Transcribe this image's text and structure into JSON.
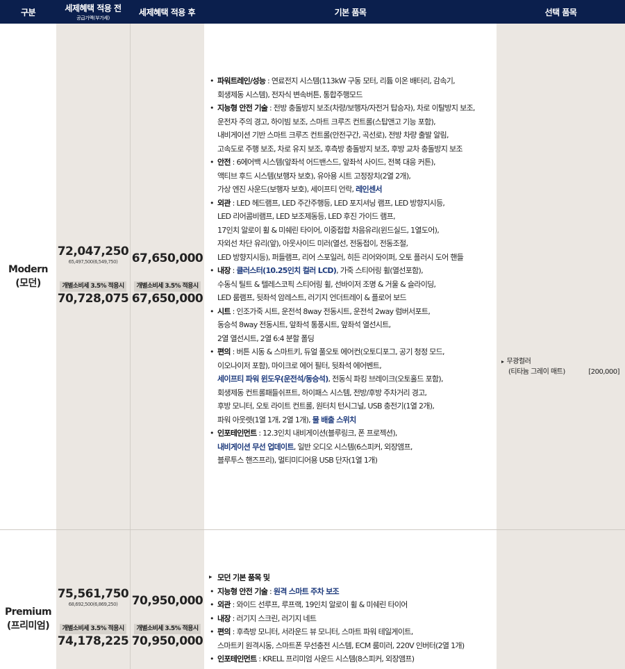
{
  "header": {
    "gubun": "구분",
    "before": "세제혜택 적용 전",
    "before_sub": "공급가액(부가세)",
    "after": "세제혜택 적용 후",
    "basic": "기본 품목",
    "option": "선택 품목"
  },
  "modern": {
    "name1": "Modern",
    "name2": "(모던)",
    "before_price": "72,047,250",
    "before_supply": "65,497,500(6,549,750)",
    "tax_label": "개별소비세 3.5% 적용시",
    "before_tax_price": "70,728,075",
    "after_price": "67,650,000",
    "after_tax_label": "개별소비세 3.5% 적용시",
    "after_tax_price": "67,650,000",
    "items": [
      {
        "cat": "파워트레인/성능",
        "parts": [
          {
            "t": " : 연료전지 시스템(113kW 구동 모터, 리튬 이온 배터리, 감속기,"
          },
          {
            "t": "회생제동 시스템), 전자식 변속버튼, 통합주행모드",
            "br": true
          }
        ]
      },
      {
        "cat": "지능형 안전 기술",
        "parts": [
          {
            "t": " : 전방 충돌방지 보조(차량/보행자/자전거 탑승자), 차로 이탈방지 보조,"
          },
          {
            "t": "운전자 주의 경고, 하이빔 보조, 스마트 크루즈 컨트롤(스탑앤고 기능 포함),",
            "br": true
          },
          {
            "t": "내비게이션 기반 스마트 크루즈 컨트롤(안전구간, 곡선로), 전방 차량 출발 알림,",
            "br": true
          },
          {
            "t": "고속도로 주행 보조, 차로 유지 보조, 후측방 충돌방지 보조, 후방 교차 충돌방지 보조",
            "br": true
          }
        ]
      },
      {
        "cat": "안전",
        "parts": [
          {
            "t": " : 6에어백 시스템(앞좌석 어드밴스드, 앞좌석 사이드, 전복 대응 커튼),"
          },
          {
            "t": "액티브 후드 시스템(보행자 보호), 유아용 시트 고정장치(2열 2개),",
            "br": true
          },
          {
            "t": "가상 엔진 사운드(보행자 보호), 세이프티 언락, ",
            "br": true
          },
          {
            "t": "레인센서",
            "hl": true
          }
        ]
      },
      {
        "cat": "외관",
        "parts": [
          {
            "t": " : LED 헤드램프, LED 주간주행등, LED 포지셔닝 램프, LED 방향지시등,"
          },
          {
            "t": "LED 리어콤비램프, LED 보조제동등, LED 후진 가이드 램프,",
            "br": true
          },
          {
            "t": "17인치 알로이 휠 & 미쉐린 타이어, 이중접합 차음유리(윈드실드, 1열도어),",
            "br": true
          },
          {
            "t": "자외선 차단 유리(앞), 아웃사이드 미러(열선, 전동접이, 전동조절,",
            "br": true
          },
          {
            "t": "LED 방향지시등), 퍼들램프, 리어 스포일러, 히든 리어와이퍼, 오토 플러시 도어 핸들",
            "br": true
          }
        ]
      },
      {
        "cat": "내장",
        "parts": [
          {
            "t": " : "
          },
          {
            "t": "클러스터(10.25인치 컬러 LCD)",
            "hl": true
          },
          {
            "t": ", 가죽 스티어링 휠(열선포함),"
          },
          {
            "t": "수동식 틸트 & 텔레스코픽 스티어링 휠, 선바이저 조명 & 거울 & 슬라이딩,",
            "br": true
          },
          {
            "t": "LED 룸램프, 뒷좌석 암레스트, 러기지 언더트레이 & 플로어 보드",
            "br": true
          }
        ]
      },
      {
        "cat": "시트",
        "parts": [
          {
            "t": " : 인조가죽 시트, 운전석 8way 전동시트, 운전석 2way 럼버서포트,"
          },
          {
            "t": "동승석 8way 전동시트, 앞좌석 통풍시트, 앞좌석 열선시트,",
            "br": true
          },
          {
            "t": "2열 열선시트, 2열 6:4 분할 폴딩",
            "br": true
          }
        ]
      },
      {
        "cat": "편의",
        "parts": [
          {
            "t": " : 버튼 시동 & 스마트키, 듀얼 풀오토 에어컨(오토디포그, 공기 청정 모드,"
          },
          {
            "t": "이오나이저 포함), 마이크로 에어 필터, 뒷좌석 에어벤트,",
            "br": true
          },
          {
            "t": "세이프티 파워 윈도우(운전석/동승석)",
            "hl": true,
            "br": true
          },
          {
            "t": ", 전동식 파킹 브레이크(오토홀드 포함),"
          },
          {
            "t": "회생제동 컨트롤패들쉬프트, 하이패스 시스템, 전방/후방 주차거리 경고,",
            "br": true
          },
          {
            "t": "후방 모니터, 오토 라이트 컨트롤, 원터치 턴시그널, USB 충전기(1열 2개),",
            "br": true
          },
          {
            "t": "파워 아웃렛(1열 1개, 2열 1개), ",
            "br": true
          },
          {
            "t": "물 배출 스위치",
            "hl": true
          }
        ]
      },
      {
        "cat": "인포테인먼트",
        "parts": [
          {
            "t": " : 12.3인치 내비게이션(블루링크, 폰 프로젝션),"
          },
          {
            "t": "내비게이션 무선 업데이트",
            "hl": true,
            "br": true
          },
          {
            "t": ", 일반 오디오 시스템(6스피커, 외장앰프,"
          },
          {
            "t": "블루투스 핸즈프리), 멀티미디어용 USB 단자(1열 1개)",
            "br": true
          }
        ]
      }
    ],
    "option": {
      "name1": "무광컬러",
      "name2": "(티타늄 그레이 매트)",
      "price": "[200,000]"
    }
  },
  "premium": {
    "name1": "Premium",
    "name2": "(프리미엄)",
    "before_price": "75,561,750",
    "before_supply": "68,692,500(6,869,250)",
    "tax_label": "개별소비세 3.5% 적용시",
    "before_tax_price": "74,178,225",
    "after_price": "70,950,000",
    "after_tax_label": "개별소비세 3.5% 적용시",
    "after_tax_price": "70,950,000",
    "items": [
      {
        "cat": "모던 기본 품목 및",
        "arrow": true,
        "parts": []
      },
      {
        "cat": "지능형 안전 기술",
        "parts": [
          {
            "t": " : "
          },
          {
            "t": "원격 스마트 주차 보조",
            "hl": true
          }
        ]
      },
      {
        "cat": "외관",
        "parts": [
          {
            "t": " : 와이드 선루프, 루프랙, 19인치 알로이 휠 & 미쉐린 타이어"
          }
        ]
      },
      {
        "cat": "내장",
        "parts": [
          {
            "t": " : 러기지 스크린, 러기지 네트"
          }
        ]
      },
      {
        "cat": "편의",
        "parts": [
          {
            "t": " : 후측방 모니터, 서라운드 뷰 모니터, 스마트 파워 테일게이트,"
          },
          {
            "t": "스마트키 원격시동, 스마트폰 무선충전 시스템, ECM 룸미러, 220V 인버터(2열 1개)",
            "br": true
          }
        ]
      },
      {
        "cat": "인포테인먼트",
        "parts": [
          {
            "t": " : KRELL 프리미엄 사운드 시스템(8스피커, 외장앰프)"
          }
        ]
      }
    ]
  }
}
